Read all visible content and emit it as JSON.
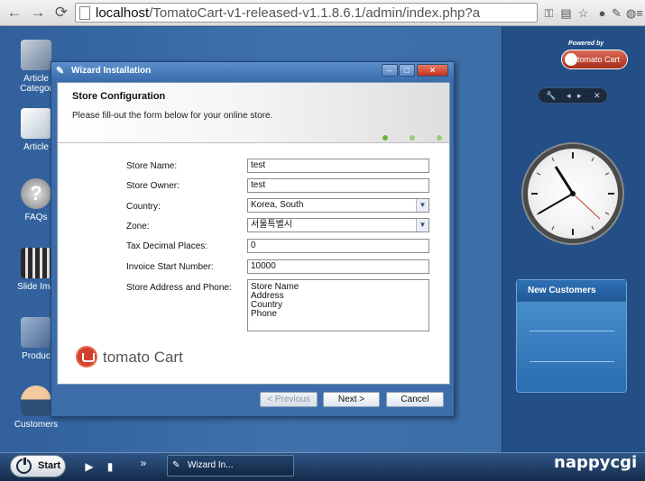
{
  "browser": {
    "url_host": "localhost",
    "url_path": "/TomatoCart-v1-released-v1.1.8.6.1/admin/index.php?a",
    "icons": [
      "back-arrow-icon",
      "forward-arrow-icon",
      "reload-icon",
      "page-icon",
      "key-icon",
      "translate-icon",
      "star-icon",
      "cookie-icon",
      "notes-icon",
      "globe-icon",
      "menu-icon"
    ]
  },
  "desktop": {
    "icons": [
      {
        "label": "Article Categor",
        "icon": "folder-icon"
      },
      {
        "label": "Article",
        "icon": "document-icon"
      },
      {
        "label": "FAQs",
        "icon": "question-icon"
      },
      {
        "label": "Slide Ima",
        "icon": "film-icon"
      },
      {
        "label": "Produc",
        "icon": "box-icon"
      },
      {
        "label": "Customers",
        "icon": "user-icon"
      }
    ]
  },
  "wizard": {
    "title": "Wizard Installation",
    "header_title": "Store Configuration",
    "header_desc": "Please fill-out the form below for your online store.",
    "fields": [
      {
        "label": "Store Name:",
        "value": "test"
      },
      {
        "label": "Store Owner:",
        "value": "test"
      },
      {
        "label": "Country:",
        "value": "Korea, South"
      },
      {
        "label": "Zone:",
        "value": "서울특별시"
      },
      {
        "label": "Tax Decimal Places:",
        "value": "0"
      },
      {
        "label": "Invoice Start Number:",
        "value": "10000"
      },
      {
        "label": "Store Address and Phone:",
        "value_lines": [
          "Store Name",
          "Address",
          "Country",
          "Phone"
        ]
      }
    ],
    "logo_text": "tomato Cart",
    "buttons": {
      "previous": "< Previous",
      "next": "Next >",
      "cancel": "Cancel"
    }
  },
  "right_panel": {
    "powered_by": "Powered by",
    "badge": "tomato Cart",
    "new_customers_title": "New Customers"
  },
  "taskbar": {
    "start": "Start",
    "task_label": "Wizard In...",
    "brand": "nappycgi"
  },
  "colors": {
    "accent": "#3c6da8",
    "step_dot": "#6cb33e"
  }
}
